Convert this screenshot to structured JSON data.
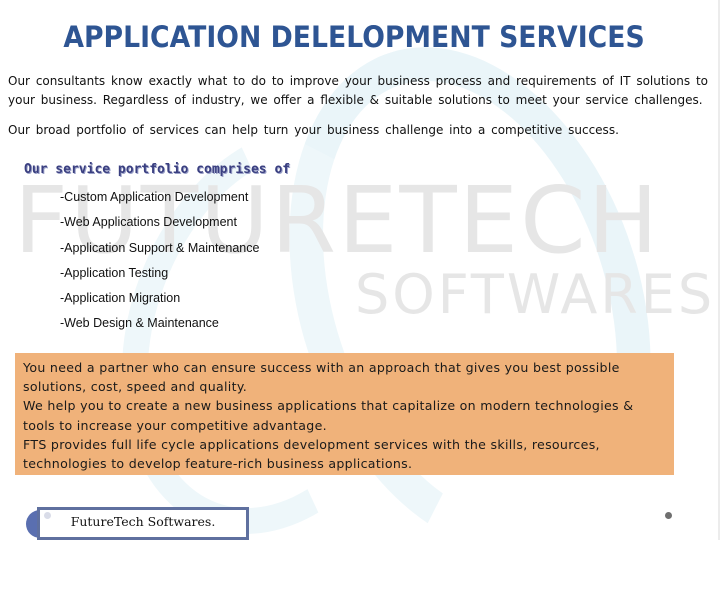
{
  "slide": {
    "title": "APPLICATION DELELOPMENT SERVICES",
    "intro_paragraph": "Our consultants know exactly what to do to improve your business process and requirements of IT solutions to your business. Regardless of industry, we offer a flexible & suitable solutions to meet your service challenges.",
    "portfolio_paragraph": "Our broad portfolio of services can help turn your business challenge into a competitive success.",
    "portfolio_heading": "Our service portfolio comprises of",
    "services": [
      "-Custom Application Development",
      "-Web Applications Development",
      "-Application Support & Maintenance",
      "-Application Testing",
      "-Application Migration",
      "-Web Design & Maintenance"
    ],
    "callout": {
      "lines": [
        "You need a partner who can ensure success  with an approach that  gives you best  possible solutions, cost,  speed and quality.",
        "We help you to create a new business applications that capitalize on modern technologies & tools to increase your competitive advantage.",
        "FTS provides full life cycle applications  development services  with the skills, resources, technologies to develop feature-rich business  applications."
      ],
      "background_color": "#f0b27a"
    },
    "footer": {
      "company_name": "FutureTech Softwares."
    },
    "watermark": {
      "line1": "FUTURETECH",
      "line2": "SOFTWARES"
    },
    "colors": {
      "title": "#2e5593",
      "heading": "#3a3f80",
      "footer_accent": "#5a6fb0"
    }
  }
}
